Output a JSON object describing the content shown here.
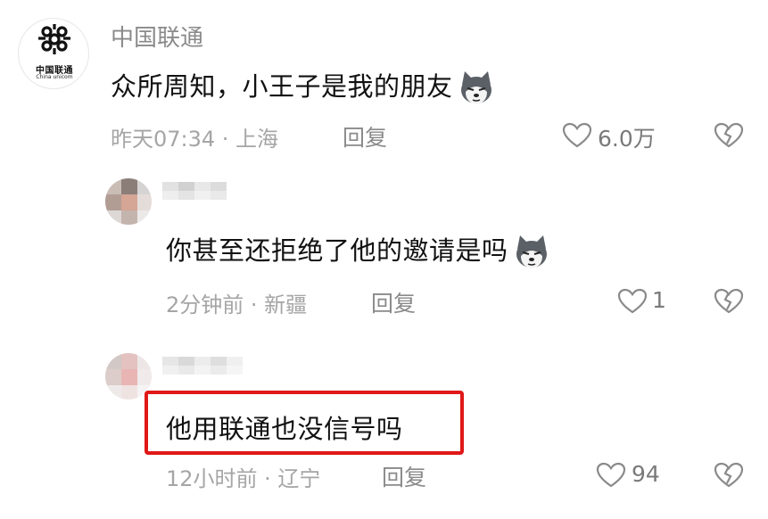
{
  "comments": [
    {
      "username": "中国联通",
      "logo_cn": "中国联通",
      "logo_en": "China unicom",
      "text": "众所周知，小王子是我的朋友",
      "emoji": "husky-dog-emoji",
      "meta": "昨天07:34 · 上海",
      "reply_label": "回复",
      "likes": "6.0万"
    },
    {
      "text": "你甚至还拒绝了他的邀请是吗",
      "emoji": "husky-dog-emoji",
      "meta": "2分钟前 · 新疆",
      "reply_label": "回复",
      "likes": "1"
    },
    {
      "text": "他用联通也没信号吗",
      "meta": "12小时前 · 辽宁",
      "reply_label": "回复",
      "likes": "94",
      "highlight_color": "#e01818"
    }
  ],
  "icons": {
    "like": "heart-outline-icon",
    "dislike": "broken-heart-icon"
  }
}
